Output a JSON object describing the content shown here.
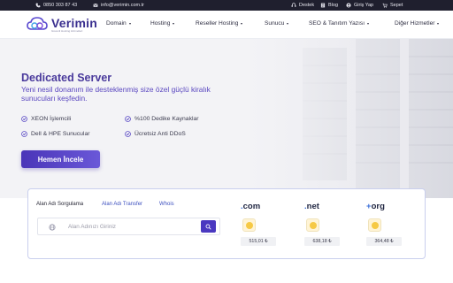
{
  "topbar": {
    "phone": "0850 303 87 43",
    "email": "info@verimin.com.tr",
    "links": [
      "Destek",
      "Blog",
      "Giriş Yap",
      "Sepet"
    ]
  },
  "brand": {
    "name": "Verimin",
    "tagline": "Güvenli Hosting Hizmetleri",
    "color": "#3a2f8f"
  },
  "nav": [
    "Domain",
    "Hosting",
    "Reseller Hosting",
    "Sunucu",
    "SEO & Tanıtım Yazısı",
    "Diğer Hizmetler"
  ],
  "hero": {
    "title": "Dedicated Server",
    "subtitle": "Yeni nesil donanım ile desteklenmiş size özel güçlü kiralık sunucuları keşfedin.",
    "features": [
      "XEON İşlemcili",
      "%100 Dedike Kaynaklar",
      "Dell & HPE Sunucular",
      "Ücretsiz Anti DDoS"
    ],
    "cta": "Hemen İncele"
  },
  "domain": {
    "tabs": [
      "Alan Adı Sorgulama",
      "Alan Adı Transfer",
      "Whois"
    ],
    "active_tab": 0,
    "search_placeholder": "Alan Adınızı Giriniz",
    "tlds": [
      {
        "dot": ".",
        "ext": "com",
        "price": "515,01 ₺"
      },
      {
        "dot": ".",
        "ext": "net",
        "price": "638,18 ₺"
      },
      {
        "dot": "+",
        "ext": "org",
        "price": "364,48 ₺"
      }
    ]
  },
  "colors": {
    "accent": "#4a38c0",
    "topbar": "#1f1f2e",
    "hero_bg": "#f3f3f6"
  }
}
